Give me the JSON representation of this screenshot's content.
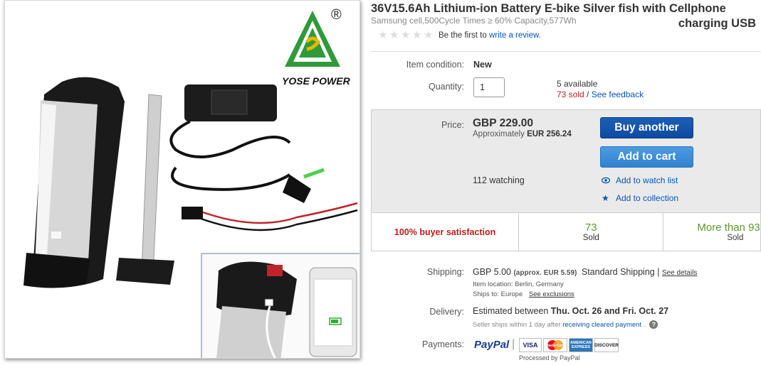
{
  "image": {
    "brand_text": "YOSE POWER",
    "registered_mark": "®"
  },
  "listing": {
    "title_line1": "36V15.6Ah Lithium-ion Battery E-bike Silver fish with Cellphone",
    "title_line2": "charging USB",
    "subtitle": "Samsung cell,500Cycle Times ≥ 60% Capacity,577Wh",
    "review_prompt": "Be the first to",
    "review_link": "write a review.",
    "stars": 5
  },
  "condition": {
    "label": "Item condition:",
    "value": "New"
  },
  "quantity": {
    "label": "Quantity:",
    "value": "1",
    "available": "5 available",
    "sold": "73 sold",
    "feedback_sep": " / ",
    "feedback_link": "See feedback"
  },
  "price": {
    "label": "Price:",
    "value": "GBP 229.00",
    "approx_prefix": "Approximately",
    "approx_value": "EUR 256.24",
    "watching": "112 watching"
  },
  "actions": {
    "buy_another": "Buy another",
    "add_to_cart": "Add to cart",
    "watch_list": "Add to watch list",
    "collection": "Add to collection"
  },
  "satisfaction": {
    "buyer": "100% buyer satisfaction",
    "sold_count": "73",
    "sold_label": "Sold",
    "more_than": "More than 93",
    "more_label": "Sold"
  },
  "shipping": {
    "label": "Shipping:",
    "cost": "GBP 5.00",
    "approx": "(approx. EUR 5.59)",
    "service": "Standard Shipping |",
    "details_link": "See details",
    "location": "Item location:  Berlin, Germany",
    "ships_to": "Ships to:  Europe",
    "exclusions_link": "See exclusions"
  },
  "delivery": {
    "label": "Delivery:",
    "prefix": "Estimated between",
    "dates": "Thu. Oct. 26 and Fri. Oct. 27",
    "note_prefix": "Seller ships within 1 day after",
    "note_link": "receiving cleared payment",
    "note_suffix": ".",
    "help_icon": "?"
  },
  "payments": {
    "label": "Payments:",
    "paypal": "PayPal",
    "cards": [
      "VISA",
      "MasterCard",
      "AMERICAN EXPRESS",
      "DISCOVER"
    ],
    "processed": "Processed by PayPal"
  },
  "colors": {
    "link": "#0654ba",
    "buy_button": "#0d4aa0",
    "cart_button": "#3082cf",
    "sold_red": "#c41a1a",
    "sold_green": "#5a9a2a"
  }
}
